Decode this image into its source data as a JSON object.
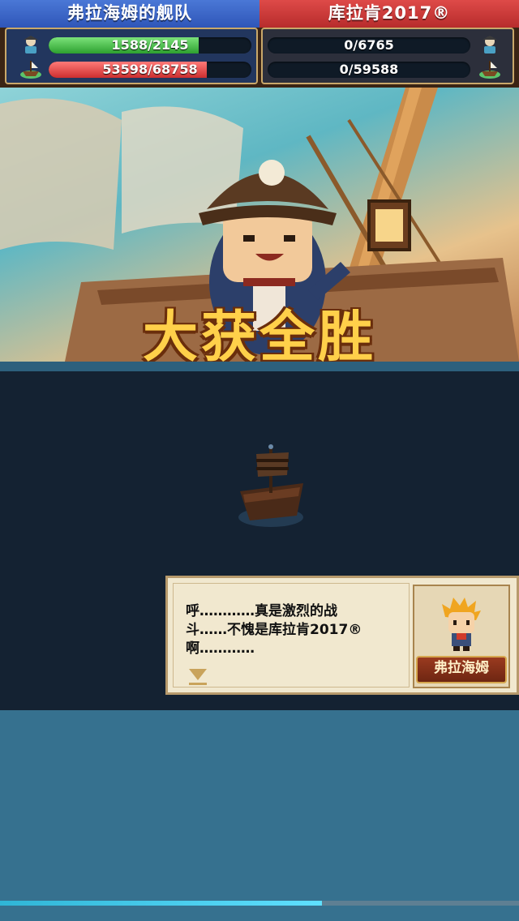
{
  "hud": {
    "left_team": {
      "name": "弗拉海姆的舰队",
      "crew": {
        "text": "1588/2145",
        "fill_fraction": 0.74
      },
      "ship": {
        "text": "53598/68758",
        "fill_fraction": 0.78
      }
    },
    "right_team": {
      "name": "库拉肯2017®",
      "crew": {
        "text": "0/6765",
        "fill_fraction": 0
      },
      "ship": {
        "text": "0/59588",
        "fill_fraction": 0
      }
    }
  },
  "banner": {
    "title": "大获全胜"
  },
  "dialog": {
    "lines": [
      "呼…………真是激烈的战",
      "斗……不愧是库拉肯2017®",
      "啊…………"
    ],
    "speaker": "弗拉海姆"
  },
  "battle_progress": {
    "fill_fraction": 0.62
  },
  "colors": {
    "left_team": "#3a63c7",
    "right_team": "#c93636",
    "sea_dark": "#142232",
    "sea_light": "#36718f"
  }
}
